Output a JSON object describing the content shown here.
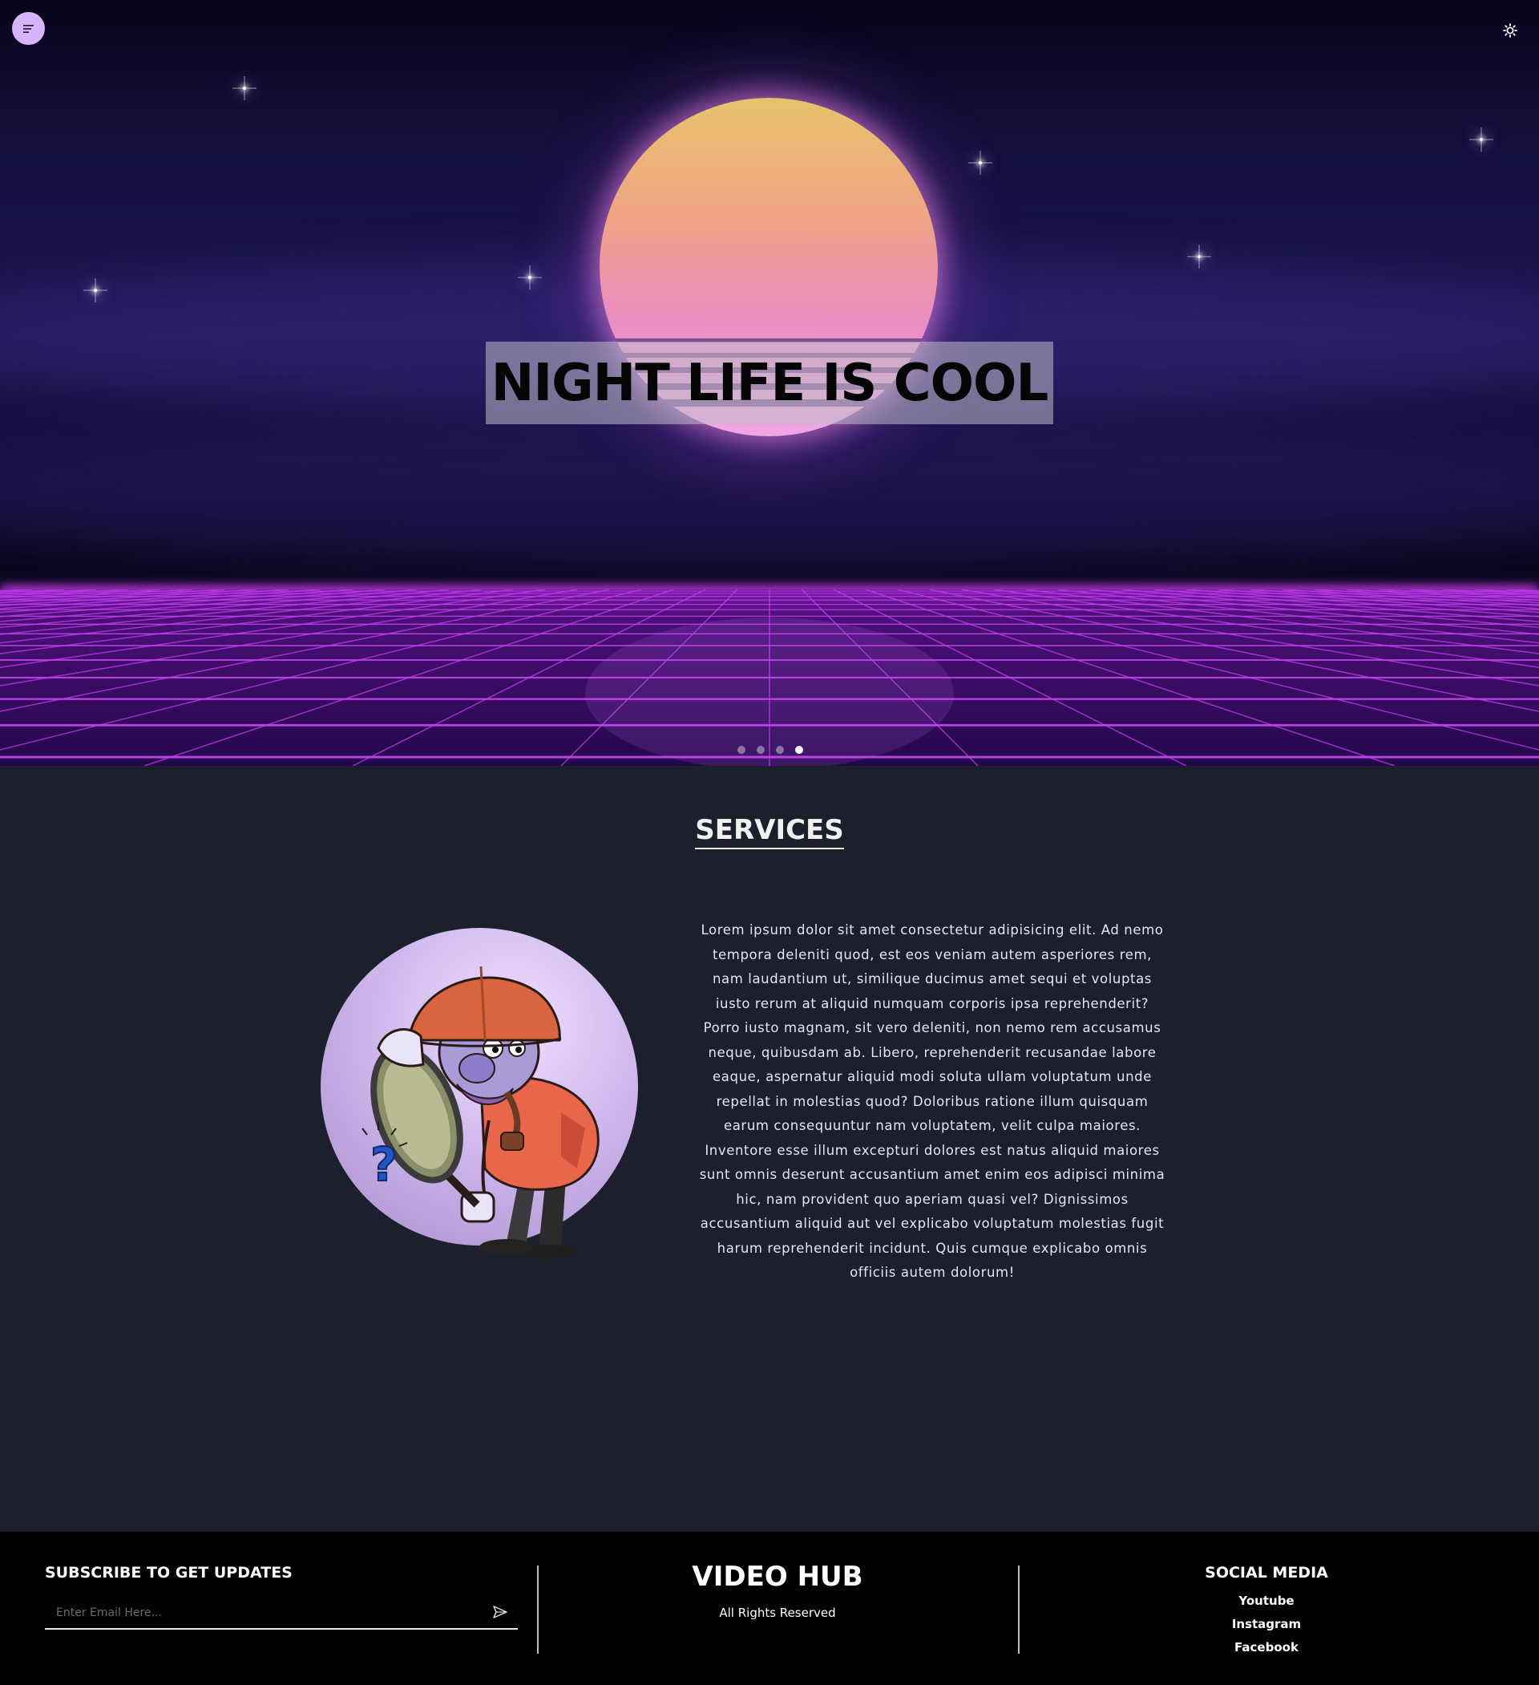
{
  "header": {
    "menu_icon": "menu-lines-icon",
    "theme_icon": "sun-gear-icon"
  },
  "hero": {
    "title": "NIGHT LIFE IS COOL",
    "slides_count": 4,
    "active_slide": 4,
    "colors": {
      "sky": "#130f3a",
      "grid": "#c026d3",
      "sun_top": "#e7c36c",
      "sun_bottom": "#f2a6e6"
    }
  },
  "services": {
    "heading": "SERVICES",
    "image_icon": "detective-magnifier-illustration",
    "paragraph": "Lorem ipsum dolor sit amet consectetur adipisicing elit. Ad nemo tempora deleniti quod, est eos veniam autem asperiores rem, nam laudantium ut, similique ducimus amet sequi et voluptas iusto rerum at aliquid numquam corporis ipsa reprehenderit? Porro iusto magnam, sit vero deleniti, non nemo rem accusamus neque, quibusdam ab. Libero, reprehenderit recusandae labore eaque, aspernatur aliquid modi soluta ullam voluptatum unde repellat in molestias quod? Doloribus ratione illum quisquam earum consequuntur nam voluptatem, velit culpa maiores. Inventore esse illum excepturi dolores est natus aliquid maiores sunt omnis deserunt accusantium amet enim eos adipisci minima hic, nam provident quo aperiam quasi vel? Dignissimos accusantium aliquid aut vel explicabo voluptatum molestias fugit harum reprehenderit incidunt. Quis cumque explicabo omnis officiis autem dolorum!"
  },
  "footer": {
    "subscribe_title": "SUBSCRIBE TO GET UPDATES",
    "email_placeholder": "Enter Email Here...",
    "send_icon": "send-arrow-icon",
    "brand": "VIDEO HUB",
    "rights": "All Rights Reserved",
    "social_title": "SOCIAL MEDIA",
    "social_links": [
      "Youtube",
      "Instagram",
      "Facebook"
    ]
  }
}
